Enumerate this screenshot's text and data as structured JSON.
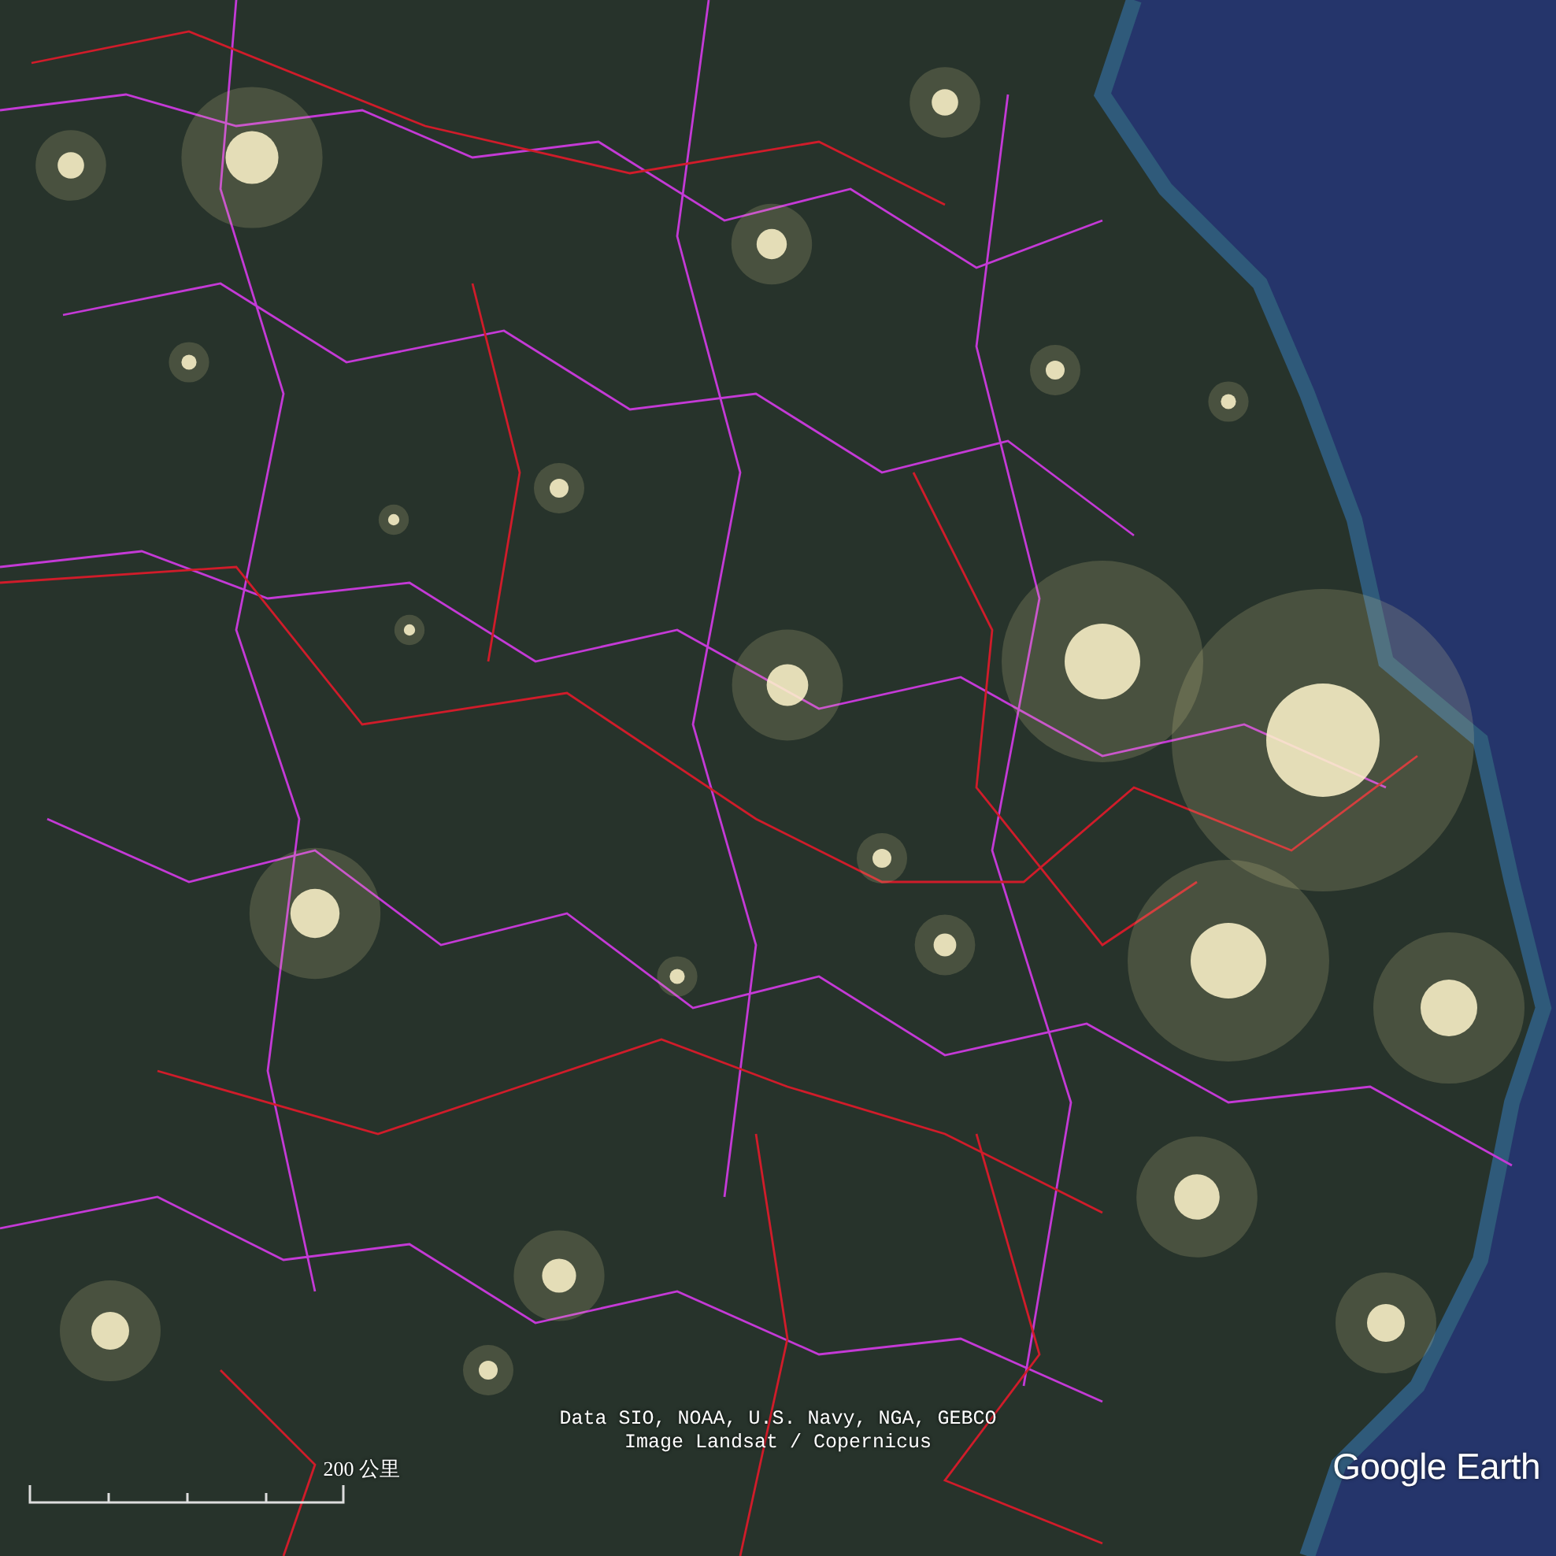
{
  "map": {
    "attribution": [
      "Data SIO, NOAA, U.S. Navy, NGA, GEBCO",
      "Image Landsat / Copernicus"
    ],
    "scale": {
      "label": "200 公里"
    },
    "logo": "Google Earth"
  }
}
